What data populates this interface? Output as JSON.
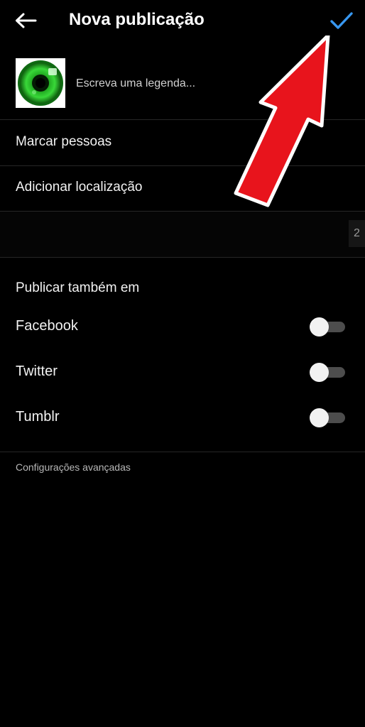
{
  "header": {
    "back_icon": "arrow-left-icon",
    "title": "Nova publicação",
    "confirm_icon": "checkmark-icon"
  },
  "post": {
    "thumbnail": "green-eye-image",
    "caption_placeholder": "Escreva uma legenda..."
  },
  "menu": {
    "tag_people": "Marcar pessoas",
    "add_location": "Adicionar localização"
  },
  "band": {
    "chip_text": "2"
  },
  "share": {
    "section_title": "Publicar também em",
    "items": [
      {
        "label": "Facebook",
        "enabled": false
      },
      {
        "label": "Twitter",
        "enabled": false
      },
      {
        "label": "Tumblr",
        "enabled": false
      }
    ]
  },
  "advanced_settings": "Configurações avançadas",
  "colors": {
    "background": "#000000",
    "accent": "#3897f0",
    "divider": "#262626",
    "annotation_arrow": "#e8141c"
  }
}
